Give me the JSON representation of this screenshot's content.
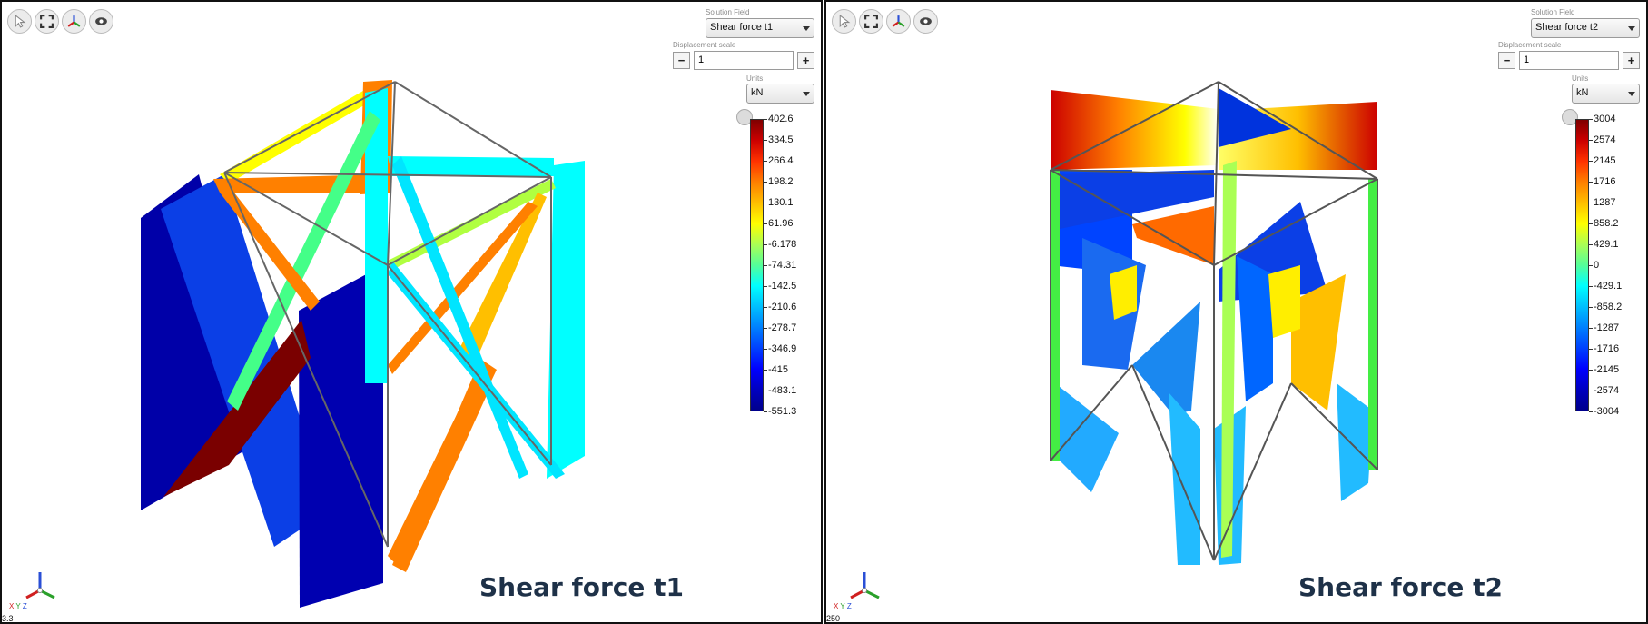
{
  "panels": [
    {
      "id": "left",
      "solution_field_label": "Solution Field",
      "solution_field_value": "Shear force t1",
      "displacement_scale_label": "Displacement scale",
      "displacement_scale_value": "1",
      "minus_label": "−",
      "plus_label": "+",
      "units_label": "Units",
      "units_value": "kN",
      "legend_ticks": [
        "402.6",
        "334.5",
        "266.4",
        "198.2",
        "130.1",
        "61.96",
        "-6.178",
        "-74.31",
        "-142.5",
        "-210.6",
        "-278.7",
        "-346.9",
        "-415",
        "-483.1",
        "-551.3"
      ],
      "caption": "Shear force t1",
      "corner_text": "3.3"
    },
    {
      "id": "right",
      "solution_field_label": "Solution Field",
      "solution_field_value": "Shear force t2",
      "displacement_scale_label": "Displacement scale",
      "displacement_scale_value": "1",
      "minus_label": "−",
      "plus_label": "+",
      "units_label": "Units",
      "units_value": "kN",
      "legend_ticks": [
        "3004",
        "2574",
        "2145",
        "1716",
        "1287",
        "858.2",
        "429.1",
        "0",
        "-429.1",
        "-858.2",
        "-1287",
        "-1716",
        "-2145",
        "-2574",
        "-3004"
      ],
      "caption": "Shear force t2",
      "corner_text": "250"
    }
  ],
  "toolbar_icons": [
    "select-cursor-icon",
    "fit-view-icon",
    "axes-triad-icon",
    "visibility-eye-icon"
  ],
  "triad_axes": {
    "x": "X",
    "y": "Y",
    "z": "Z"
  },
  "colormap": [
    "#7f0000",
    "#cc0000",
    "#ff3300",
    "#ff7f00",
    "#ffbf00",
    "#ffff00",
    "#aaff55",
    "#55ff99",
    "#00ffff",
    "#00bfff",
    "#0080ff",
    "#0040ff",
    "#0000ff",
    "#0000bf",
    "#00008b"
  ]
}
